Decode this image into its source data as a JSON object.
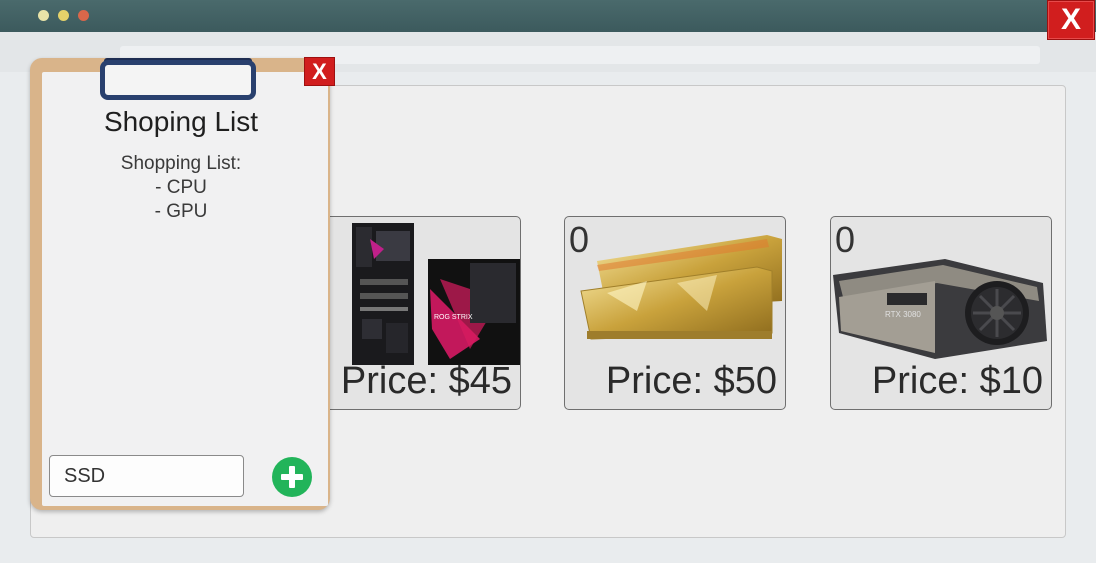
{
  "window": {
    "close_label": "X"
  },
  "clipboard": {
    "close_label": "X",
    "title": "Shoping List",
    "list_heading": "Shopping List:",
    "items": [
      "- CPU",
      "- GPU"
    ],
    "input_value": "SSD",
    "add_icon": "plus-circle-icon"
  },
  "products": [
    {
      "name": "motherboard",
      "quantity": "",
      "price_label": "Price: $45"
    },
    {
      "name": "ram",
      "quantity": "0",
      "price_label": "Price: $50"
    },
    {
      "name": "gpu",
      "quantity": "0",
      "price_label": "Price: $10"
    }
  ],
  "colors": {
    "close_red": "#d11e1e",
    "add_green": "#22b45a",
    "titlebar": "#3c5a5d",
    "clipboard_wood": "#d9b48a"
  }
}
